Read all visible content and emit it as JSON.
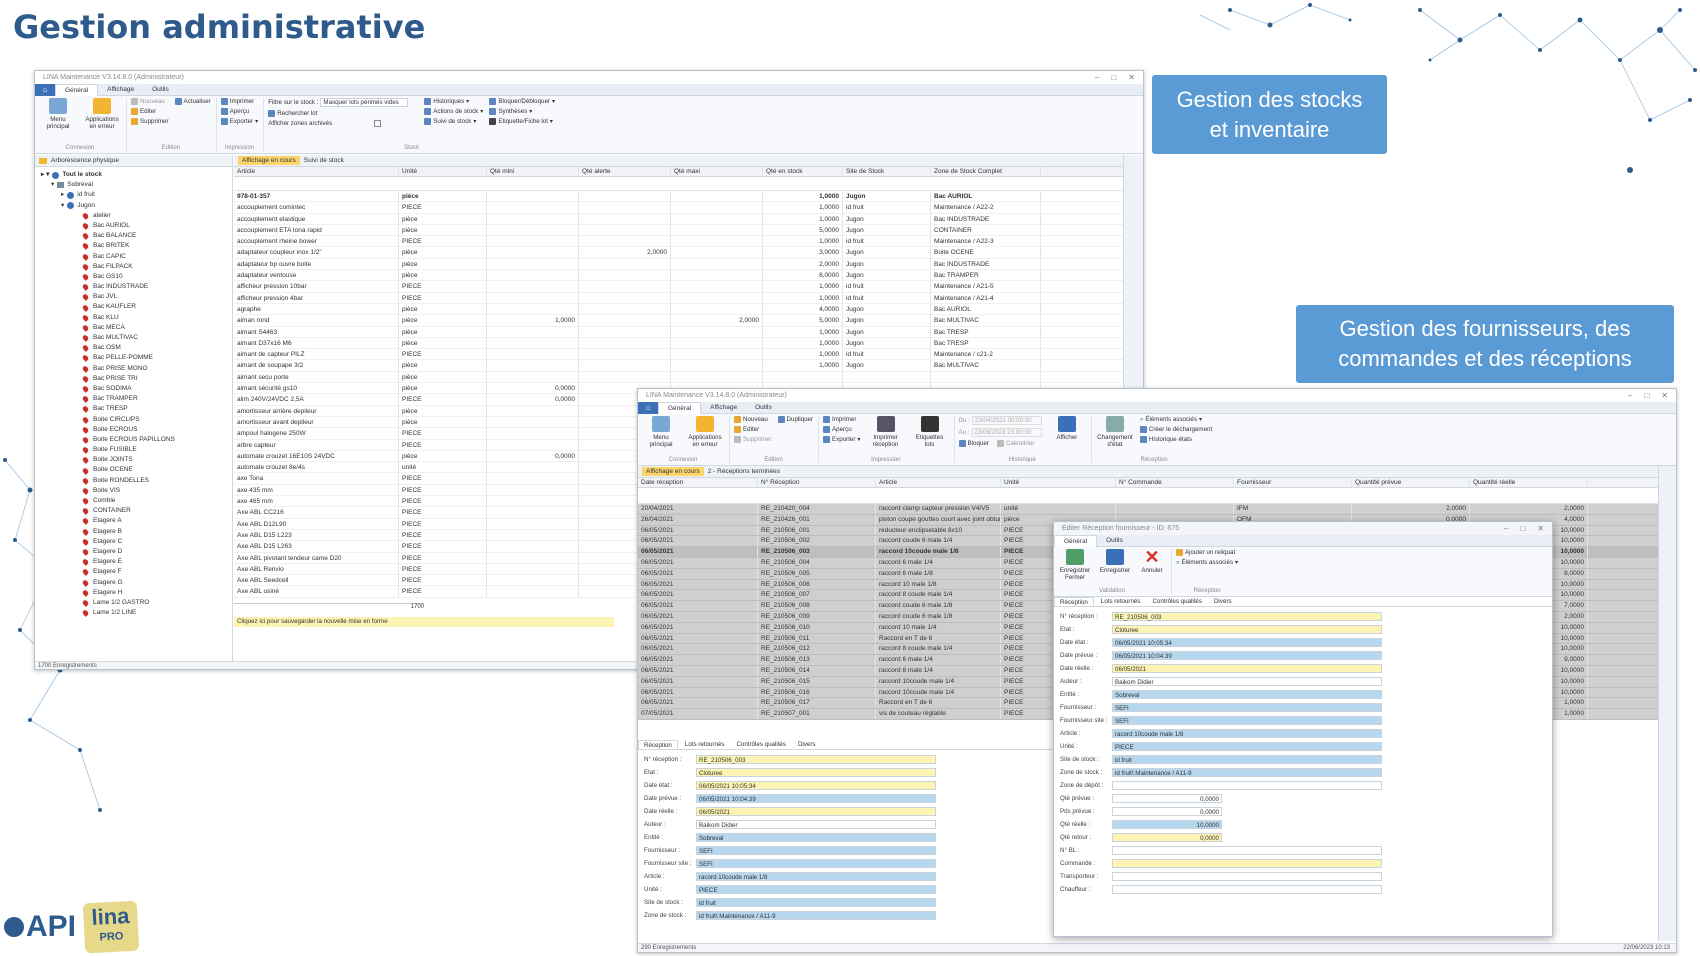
{
  "slide": {
    "title": "Gestion administrative",
    "callout1": "Gestion des stocks et inventaire",
    "callout2": "Gestion des fournisseurs, des commandes et des réceptions",
    "colors": {
      "title": "#2e5b8c",
      "callout": "#5b9bd5",
      "yellow_field": "#fdf4b3",
      "blue_field": "#b6d7ee"
    }
  },
  "logo": {
    "api": "API",
    "lina": "lina",
    "pro": "PRO"
  },
  "win1": {
    "title": "LINA Maintenance V3.14.8.0 (Administrateur)",
    "tabs": [
      "Général",
      "Affichage",
      "Outils"
    ],
    "ribbon": {
      "menu_principal": "Menu principal",
      "apps_erreur": "Applications en erreur",
      "nouveau": "Nouveau",
      "editer": "Editer",
      "supprimer": "Supprimer",
      "actualiser": "Actualiser",
      "imprimer": "Imprimer",
      "apercu": "Aperçu",
      "exporter": "Exporter",
      "filtre": "Filtre sur le stock :",
      "filtre_val": "Masquer lots périmés vides",
      "rechercher": "Rechercher lot",
      "afficher_zones": "Afficher zones archivés",
      "historiques": "Historiques",
      "actions": "Actions de stock",
      "suivi": "Suivi de stock",
      "bloquer": "Bloquer/Débloquer",
      "syntheses": "Synthèses",
      "etiquette": "Etiquette/Fiche lot",
      "g_connexion": "Connexion",
      "g_edition": "Edition",
      "g_impression": "Impression",
      "g_stock": "Stock"
    },
    "tree": {
      "header": "Arborescence physique",
      "root": "Tout le stock",
      "sobreval": "Sobreval",
      "idfruit": "id fruit",
      "jugon": "Jugon",
      "items": [
        "atelier",
        "Bac AURIOL",
        "Bac BALANCE",
        "Bac BRITEK",
        "Bac CAPIC",
        "Bac FILPACK",
        "Bac GS10",
        "Bac INDUSTRADE",
        "Bac JVL",
        "Bac KAUFLER",
        "Bac KLU",
        "Bac MECA",
        "Bac MULTIVAC",
        "Bac OSM",
        "Bac PELLE-POMME",
        "Bac PRISE MONO",
        "Bac PRISE TRI",
        "Bac SODIMA",
        "Bac TRAMPER",
        "Bac TRESP",
        "Boite CIRCLIPS",
        "Boite ECROUS",
        "Boite ECROUS PAPILLONS",
        "Boite FUSIBLE",
        "Boite JOINTS",
        "Boite OCENE",
        "Boite RONDELLES",
        "Boite VIS",
        "Comble",
        "CONTAINER",
        "Etagere A",
        "Etagere B",
        "Etagere C",
        "Etagere D",
        "Etagere E",
        "Etagere F",
        "Etagere G",
        "Etagere H",
        "Lame 1/2 GASTRO",
        "Lame 1/2 LINE"
      ],
      "count": "1700 Enregistrements"
    },
    "grid": {
      "chip": "Affichage en cours",
      "title": "Suivi de stock",
      "columns": [
        "Article",
        "Unité",
        "Qté mini",
        "Qté alerte",
        "Qté maxi",
        "Qté en stock",
        "Site de Stock",
        "Zone de Stock Complet"
      ],
      "rows": [
        [
          "978-01-357",
          "pièce",
          "",
          "",
          "",
          "1,0000",
          "Jugon",
          "Bac AURIOL"
        ],
        [
          "accouplement comintec",
          "PIECE",
          "",
          "",
          "",
          "1,0000",
          "id fruit",
          "Maintenance / A22-2"
        ],
        [
          "accouplement elastique",
          "pièce",
          "",
          "",
          "",
          "1,0000",
          "Jugon",
          "Bac INDUSTRADE"
        ],
        [
          "accouplement ETA tona rapid",
          "pièce",
          "",
          "",
          "",
          "5,0000",
          "Jugon",
          "CONTAINER"
        ],
        [
          "accouplement rheine bower",
          "PIECE",
          "",
          "",
          "",
          "1,0000",
          "id fruit",
          "Maintenance / A22-3"
        ],
        [
          "adaptateur coupleur inox 1/2\"",
          "pièce",
          "",
          "2,0000",
          "",
          "3,0000",
          "Jugon",
          "Boite OCENE"
        ],
        [
          "adaptateur bp ouvre boite",
          "pièce",
          "",
          "",
          "",
          "2,0000",
          "Jugon",
          "Bac INDUSTRADE"
        ],
        [
          "adaptateur ventouse",
          "pièce",
          "",
          "",
          "",
          "8,0000",
          "Jugon",
          "Bac TRAMPER"
        ],
        [
          "afficheur pression 10bar",
          "PIECE",
          "",
          "",
          "",
          "1,0000",
          "id fruit",
          "Maintenance / A21-5"
        ],
        [
          "afficheur pression 4bar",
          "PIECE",
          "",
          "",
          "",
          "1,0000",
          "id fruit",
          "Maintenance / A21-4"
        ],
        [
          "agraphe",
          "pièce",
          "",
          "",
          "",
          "4,0000",
          "Jugon",
          "Bac AURIOL"
        ],
        [
          "aiman rond",
          "pièce",
          "1,0000",
          "",
          "2,0000",
          "5,0000",
          "Jugon",
          "Bac MULTIVAC"
        ],
        [
          "aimant S4463",
          "pièce",
          "",
          "",
          "",
          "1,0000",
          "Jugon",
          "Bac TRESP"
        ],
        [
          "aimant D37x16 M6",
          "pièce",
          "",
          "",
          "",
          "1,0000",
          "Jugon",
          "Bac TRESP"
        ],
        [
          "aimant de capteur PILZ",
          "PIECE",
          "",
          "",
          "",
          "1,0000",
          "id fruit",
          "Maintenance / c21-2"
        ],
        [
          "aimant de soupape 3/2",
          "pièce",
          "",
          "",
          "",
          "1,0000",
          "Jugon",
          "Bac MULTIVAC"
        ],
        [
          "aimant secu porte",
          "pièce",
          "",
          "",
          "",
          "",
          "",
          ""
        ],
        [
          "aimant sécurité gs10",
          "pièce",
          "0,0000",
          "",
          "",
          "",
          "",
          ""
        ],
        [
          "alim 240V/24VDC 2,5A",
          "PIECE",
          "0,0000",
          "",
          "",
          "",
          "",
          ""
        ],
        [
          "amortisseur arrière depileur",
          "pièce",
          "",
          "",
          "",
          "",
          "",
          ""
        ],
        [
          "amortisseur avant depileur",
          "pièce",
          "",
          "",
          "",
          "",
          "",
          ""
        ],
        [
          "ampoul halogene 250W",
          "PIECE",
          "",
          "",
          "",
          "",
          "",
          ""
        ],
        [
          "arbre capteur",
          "PIECE",
          "",
          "",
          "",
          "",
          "",
          ""
        ],
        [
          "automate crouzet 16E10S 24VDC",
          "pièce",
          "0,0000",
          "",
          "",
          "",
          "",
          ""
        ],
        [
          "automate crouzet 8e/4s",
          "unité",
          "",
          "",
          "",
          "",
          "",
          ""
        ],
        [
          "axe Tona",
          "PIECE",
          "",
          "",
          "",
          "",
          "",
          ""
        ],
        [
          "axe 435 mm",
          "PIECE",
          "",
          "",
          "",
          "",
          "",
          ""
        ],
        [
          "axe 465 mm",
          "PIECE",
          "",
          "",
          "",
          "",
          "",
          ""
        ],
        [
          "Axe ABL CC216",
          "PIECE",
          "",
          "",
          "",
          "",
          "",
          ""
        ],
        [
          "Axe ABL D12L90",
          "PIECE",
          "",
          "",
          "",
          "",
          "",
          ""
        ],
        [
          "Axe ABL D15 L223",
          "PIECE",
          "",
          "",
          "",
          "",
          "",
          ""
        ],
        [
          "Axe ABL D15 L263",
          "PIECE",
          "",
          "",
          "",
          "",
          "",
          ""
        ],
        [
          "Axe ABL pivotant tendeur came D20",
          "PIECE",
          "",
          "",
          "",
          "",
          "",
          ""
        ],
        [
          "Axe ABL Renvio",
          "PIECE",
          "",
          "",
          "",
          "",
          "",
          ""
        ],
        [
          "Axe ABL Seedcell",
          "PIECE",
          "",
          "",
          "",
          "",
          "",
          ""
        ],
        [
          "Axe ABL usiné",
          "PIECE",
          "",
          "",
          "",
          "",
          "",
          ""
        ]
      ],
      "total": "1700",
      "hint": "Cliquez ici pour sauvegarder la nouvelle mise en forme"
    }
  },
  "win2": {
    "title": "LINA Maintenance V3.14.8.0 (Administrateur)",
    "tabs": [
      "Général",
      "Affichage",
      "Outils"
    ],
    "ribbon": {
      "menu_principal": "Menu principal",
      "apps_erreur": "Applications en erreur",
      "nouveau": "Nouveau",
      "dupliquer": "Dupliquer",
      "editer": "Editer",
      "supprimer": "Supprimer",
      "imprimer": "Imprimer",
      "apercu": "Aperçu",
      "exporter": "Exporter",
      "imprimer_reception": "Imprimer réception",
      "etiquettes_lots": "Etiquettes lots",
      "du": "Du :",
      "du_val": "23/04/2021 00:00:00",
      "au": "Au :",
      "au_val": "23/06/2023 23:00:00",
      "bloquer": "Bloquer",
      "calendrier": "Calendrier",
      "afficher": "Afficher",
      "changement": "Changement d'état",
      "elements": "Éléments associés",
      "creer_dechargement": "Créer le déchargement",
      "historique": "Historique états",
      "g_connexion": "Connexion",
      "g_edition": "Edition",
      "g_impression": "Impression",
      "g_historique": "Historique",
      "g_reception": "Réception"
    },
    "grid": {
      "chip": "Affichage en cours",
      "title": "2 - Réceptions terminées",
      "columns": [
        "Date réception",
        "N° Réception",
        "Article",
        "Unité",
        "N° Commande",
        "Fournisseur",
        "Quantité prévue",
        "Quantité réelle"
      ],
      "rows": [
        [
          "20/04/2021",
          "RE_210420_004",
          "raccord clamp capteur pression V4/V5",
          "unité",
          "",
          "IFM",
          "2,0000",
          "2,0000"
        ],
        [
          "26/04/2021",
          "RE_210426_001",
          "piston coupe gouttes court avec joint obtur...",
          "pièce",
          "",
          "OFM",
          "0,0000",
          "4,0000"
        ],
        [
          "06/05/2021",
          "RE_210506_001",
          "reducteur enclipsetable 8x10",
          "PIECE",
          "",
          "",
          "",
          "10,0000"
        ],
        [
          "06/05/2021",
          "RE_210506_002",
          "raccord coude 6 male 1/4",
          "PIECE",
          "",
          "",
          "",
          "10,0000"
        ],
        [
          "06/05/2021",
          "RE_210506_003",
          "raccord 10coude male 1/8",
          "PIECE",
          "",
          "",
          "",
          "10,0000"
        ],
        [
          "06/05/2021",
          "RE_210506_004",
          "raccord 6 male 1/4",
          "PIECE",
          "",
          "",
          "",
          "10,0000"
        ],
        [
          "06/05/2021",
          "RE_210506_005",
          "raccord 6 male 1/8",
          "PIECE",
          "",
          "",
          "",
          "8,0000"
        ],
        [
          "06/05/2021",
          "RE_210506_006",
          "raccord 10 male 1/8",
          "PIECE",
          "",
          "",
          "",
          "10,0000"
        ],
        [
          "06/05/2021",
          "RE_210506_007",
          "raccord 8 coude male 1/4",
          "PIECE",
          "",
          "",
          "",
          "10,0000"
        ],
        [
          "06/05/2021",
          "RE_210506_008",
          "raccord coude 6 male 1/8",
          "PIECE",
          "",
          "",
          "",
          "7,0000"
        ],
        [
          "06/05/2021",
          "RE_210506_009",
          "raccord coude 6 male 1/8",
          "PIECE",
          "",
          "",
          "",
          "2,0000"
        ],
        [
          "06/05/2021",
          "RE_210506_010",
          "raccord 10 male 1/4",
          "PIECE",
          "",
          "",
          "",
          "10,0000"
        ],
        [
          "06/05/2021",
          "RE_210506_011",
          "Raccord en T de 8",
          "PIECE",
          "",
          "",
          "",
          "10,0000"
        ],
        [
          "06/05/2021",
          "RE_210506_012",
          "raccord 8 coude male 1/4",
          "PIECE",
          "",
          "",
          "",
          "10,0000"
        ],
        [
          "06/05/2021",
          "RE_210506_013",
          "raccord 6 male 1/4",
          "PIECE",
          "",
          "",
          "",
          "9,0000"
        ],
        [
          "06/05/2021",
          "RE_210506_014",
          "raccord 8 male 1/4",
          "PIECE",
          "",
          "",
          "",
          "10,0000"
        ],
        [
          "06/05/2021",
          "RE_210506_015",
          "raccord 10coude male 1/4",
          "PIECE",
          "",
          "",
          "",
          "10,0000"
        ],
        [
          "06/05/2021",
          "RE_210506_016",
          "raccord 10coude male 1/4",
          "PIECE",
          "",
          "",
          "",
          "10,0000"
        ],
        [
          "06/05/2021",
          "RE_210506_017",
          "Raccord en T de 6",
          "PIECE",
          "",
          "",
          "",
          "1,0000"
        ],
        [
          "07/05/2021",
          "RE_210507_001",
          "vis de couteau réglable",
          "PIECE",
          "",
          "",
          "",
          "1,0000"
        ]
      ],
      "count": "290 Enregistrements",
      "date": "22/06/2023 10:13"
    },
    "detail": {
      "tabs": [
        "Réception",
        "Lots retournés",
        "Contrôles qualités",
        "Divers"
      ],
      "fields": [
        {
          "label": "N° réception :",
          "value": "RE_210506_003",
          "style": "yellow"
        },
        {
          "label": "Etat :",
          "value": "Cloturee",
          "style": "yellow"
        },
        {
          "label": "Date état :",
          "value": "06/05/2021 10:05:34",
          "style": "yellow"
        },
        {
          "label": "Date prévue :",
          "value": "06/05/2021 10:04:39",
          "style": "blue"
        },
        {
          "label": "Date réelle :",
          "value": "06/05/2021",
          "style": "yellow"
        },
        {
          "label": "Auteur :",
          "value": "Baikom Didier",
          "style": ""
        },
        {
          "label": "Entité :",
          "value": "Sobreval",
          "style": "blue"
        },
        {
          "label": "Fournisseur :",
          "value": "SEFI",
          "style": "blue"
        },
        {
          "label": "Fournisseur site :",
          "value": "SEFI",
          "style": "blue"
        },
        {
          "label": "Article :",
          "value": "racord 10coude male 1/8",
          "style": "blue"
        },
        {
          "label": "Unité :",
          "value": "PIECE",
          "style": "blue"
        },
        {
          "label": "Site de stock :",
          "value": "id fruit",
          "style": "blue"
        },
        {
          "label": "Zone de stock :",
          "value": "id fruit\\ Maintenance / A11-9",
          "style": "blue"
        }
      ]
    }
  },
  "dialog": {
    "title": "Editer Réception fournisseur - ID: 675",
    "tabs": [
      "Général",
      "Outils"
    ],
    "ribbon": {
      "enregistrer_fermer": "Enregistrer Fermer",
      "enregistrer": "Enregistrer",
      "annuler": "Annuler",
      "ajouter_reliquat": "Ajouter un reliquat",
      "elements": "Éléments associés",
      "g_validation": "Validation",
      "g_reception": "Réception"
    },
    "subtabs": [
      "Réception",
      "Lots retournés",
      "Contrôles qualités",
      "Divers"
    ],
    "fields": [
      {
        "label": "N° réception :",
        "value": "RE_210506_003",
        "style": "yellow"
      },
      {
        "label": "Etat :",
        "value": "Cloturee",
        "style": "yellow"
      },
      {
        "label": "Date état :",
        "value": "06/05/2021 10:05:34",
        "style": "blue"
      },
      {
        "label": "Date prévue :",
        "value": "06/05/2021 10:04:39",
        "style": "blue"
      },
      {
        "label": "Date réelle :",
        "value": "06/05/2021",
        "style": "yellow"
      },
      {
        "label": "Auteur :",
        "value": "Baikom Didier",
        "style": ""
      },
      {
        "label": "Entité :",
        "value": "Sobreval",
        "style": "blue"
      },
      {
        "label": "Fournisseur :",
        "value": "SEFI",
        "style": "blue"
      },
      {
        "label": "Fournisseur site :",
        "value": "SEFI",
        "style": "blue"
      },
      {
        "label": "Article :",
        "value": "racord 10coude male 1/8",
        "style": "blue"
      },
      {
        "label": "Unité :",
        "value": "PIECE",
        "style": "blue"
      },
      {
        "label": "Site de stock :",
        "value": "id fruit",
        "style": "blue"
      },
      {
        "label": "Zone de stock :",
        "value": "id fruit\\ Maintenance / A11-9",
        "style": "blue"
      },
      {
        "label": "Zone de dépôt :",
        "value": "",
        "style": ""
      },
      {
        "label": "Qté prévue :",
        "value": "0,0000",
        "style": "num"
      },
      {
        "label": "Pds prévue :",
        "value": "0,0000",
        "style": "num"
      },
      {
        "label": "Qté réelle :",
        "value": "10,0000",
        "style": "numblue"
      },
      {
        "label": "Qté retour :",
        "value": "0,0000",
        "style": "numyellow"
      },
      {
        "label": "N° BL :",
        "value": "",
        "style": ""
      },
      {
        "label": "Commande :",
        "value": "",
        "style": "yellow"
      },
      {
        "label": "Transporteur :",
        "value": "",
        "style": ""
      },
      {
        "label": "Chauffeur :",
        "value": "",
        "style": ""
      }
    ]
  }
}
